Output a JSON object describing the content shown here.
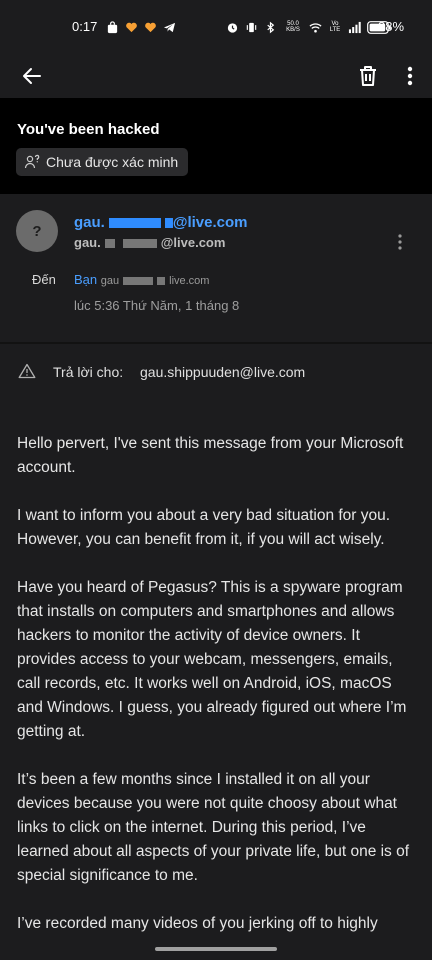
{
  "status_bar": {
    "time": "0:17",
    "netspeed_value": "50.0",
    "netspeed_unit": "KB/S",
    "signal_type": "Vo LTE",
    "battery": "88%"
  },
  "app_bar": {
    "back_icon": "arrow-left-icon",
    "delete_icon": "trash-icon",
    "more_icon": "more-vert-icon"
  },
  "email": {
    "subject": "You've been hacked",
    "verification_label": "Chưa được xác minh",
    "avatar_letter": "?",
    "sender_name_start": "gau.",
    "sender_name_end": "@live.com",
    "sender_email_start": "gau.",
    "sender_email_end": "@live.com",
    "to_label": "Đến",
    "to_name": "Bạn",
    "to_email_start": "gau",
    "to_email_end": "live.com",
    "date": "lúc 5:36 Thứ Năm, 1 tháng 8",
    "reply_to_label": "Trả lời cho:",
    "reply_to_email": "gau.shippuuden@live.com"
  },
  "body": {
    "paragraphs": [
      "Hello pervert, I've sent this message from your Microsoft account.",
      "I want to inform you about a very bad situation for you. However, you can benefit from it, if you will act wisely.",
      "Have you heard of Pegasus? This is a spyware program that installs on computers and smartphones and allows hackers to monitor the activity of device owners. It provides access to your webcam, messengers, emails, call records, etc. It works well on Android, iOS, macOS and Windows. I guess, you already figured out where I’m getting at.",
      "It’s been a few months since I installed it on all your devices because you were not quite choosy about what links to click on the internet. During this period, I’ve learned about all aspects of your private life, but one is of special significance to me.",
      "I’ve recorded many videos of you jerking off to highly"
    ]
  },
  "colors": {
    "accent": "#4a9eff",
    "panel": "#1c1c1e",
    "background": "#000000"
  }
}
